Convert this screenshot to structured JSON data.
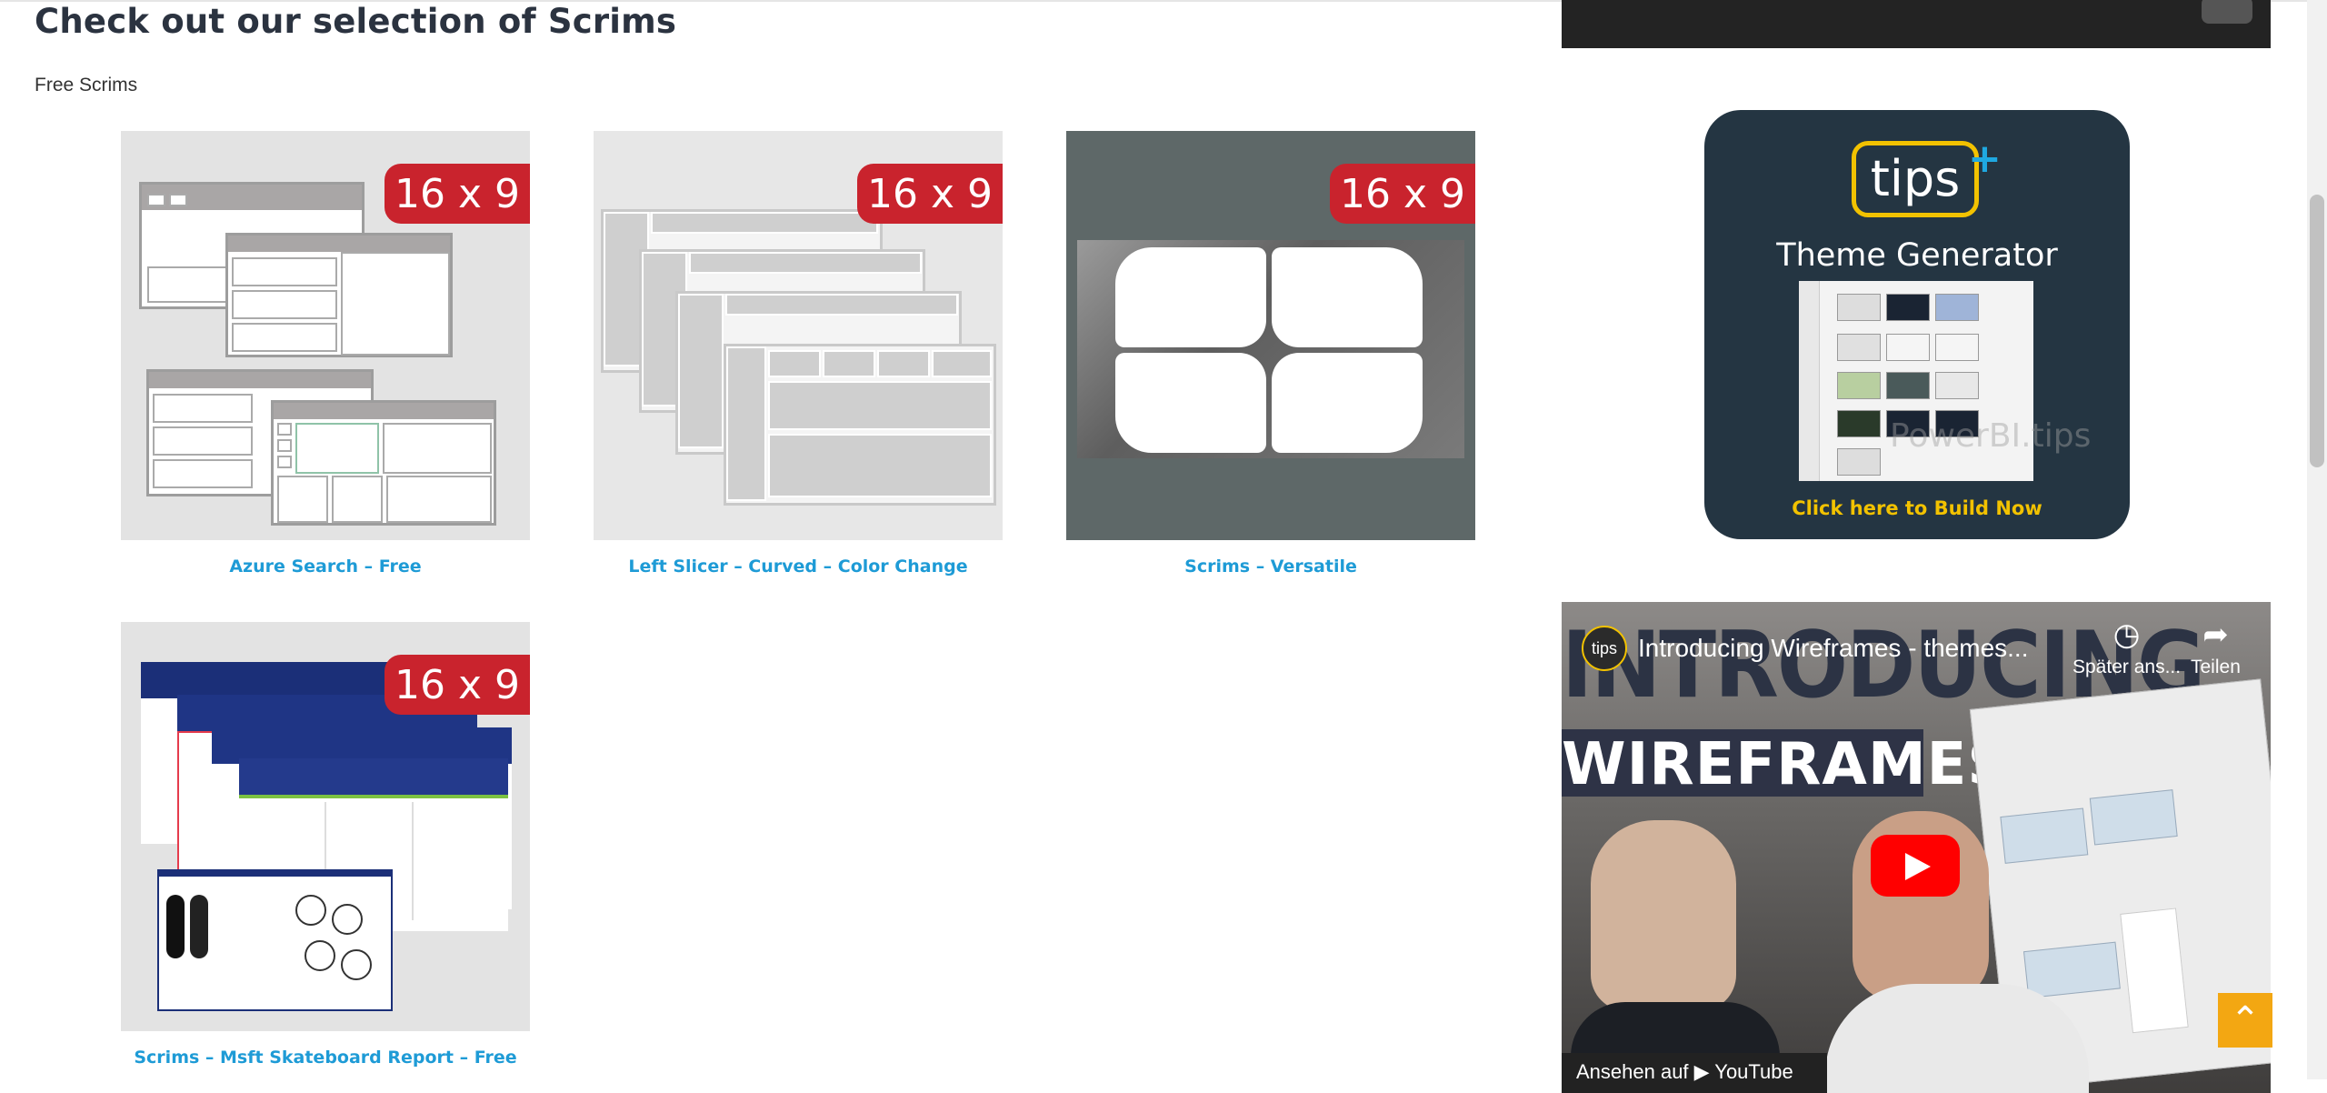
{
  "page": {
    "title": "Check out our selection of Scrims",
    "subheading": "Free Scrims"
  },
  "scrims": [
    {
      "badge": "16 x 9",
      "label": "Azure Search – Free"
    },
    {
      "badge": "16 x 9",
      "label": "Left Slicer – Curved – Color Change"
    },
    {
      "badge": "16 x 9",
      "label": "Scrims – Versatile"
    },
    {
      "badge": "16 x 9",
      "label": "Scrims – Msft Skateboard Report – Free"
    }
  ],
  "sidebar": {
    "tips_card": {
      "logo_text": "tips",
      "logo_plus": "+",
      "title": "Theme Generator",
      "cta": "Click here to Build Now",
      "watermark": "PowerBI.tips"
    },
    "video": {
      "channel_logo": "tips",
      "title": "Introducing Wireframes - themes...",
      "watch_later_label": "Später ans...",
      "share_label": "Teilen",
      "bg_text_1": "INTRODUCING",
      "bg_text_2": "WIREFRAMES",
      "bottom_text": "Ansehen auf ▶ YouTube"
    }
  },
  "colors": {
    "badge": "#c9232d",
    "link": "#1e9bd6",
    "tips_bg": "#243542",
    "tips_accent": "#f2c200",
    "back_to_top": "#f3a712"
  },
  "icons": {
    "back_to_top": "chevron-up-icon",
    "youtube_play": "play-icon",
    "watch_later": "clock-icon",
    "share": "share-icon"
  }
}
